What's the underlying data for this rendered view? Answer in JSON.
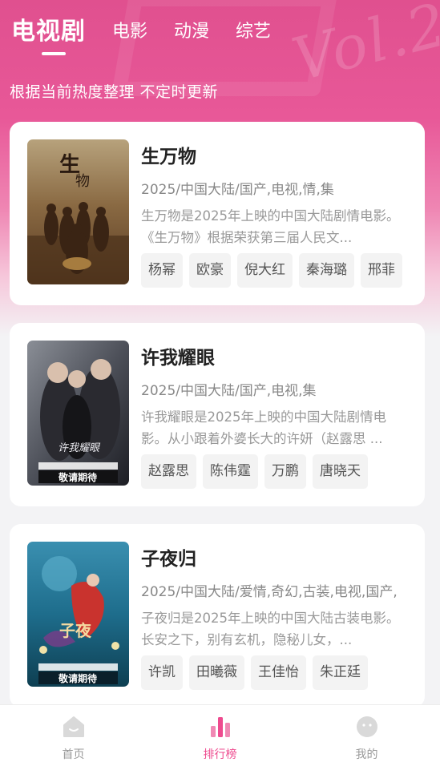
{
  "tabs": [
    {
      "label": "电视剧",
      "active": true
    },
    {
      "label": "电影",
      "active": false
    },
    {
      "label": "动漫",
      "active": false
    },
    {
      "label": "综艺",
      "active": false
    }
  ],
  "subtitle": "根据当前热度整理 不定时更新",
  "cards": [
    {
      "title": "生万物",
      "meta": "2025/中国大陆/国产,电视,情,集",
      "description": "生万物是2025年上映的中国大陆剧情电影。《生万物》根据荣获第三届人民文...",
      "actors": [
        "杨幂",
        "欧豪",
        "倪大红",
        "秦海璐",
        "邢菲"
      ]
    },
    {
      "title": "许我耀眼",
      "meta": "2025/中国大陆/国产,电视,集",
      "description": "许我耀眼是2025年上映的中国大陆剧情电影。从小跟着外婆长大的许妍（赵露思 ...",
      "actors": [
        "赵露思",
        "陈伟霆",
        "万鹏",
        "唐晓天"
      ],
      "poster_caption": "敬请期待"
    },
    {
      "title": "子夜归",
      "meta": "2025/中国大陆/爱情,奇幻,古装,电视,国产,",
      "description": "子夜归是2025年上映的中国大陆古装电影。长安之下，别有玄机，隐秘儿女，...",
      "actors": [
        "许凯",
        "田曦薇",
        "王佳怡",
        "朱正廷"
      ],
      "poster_caption": "敬请期待"
    }
  ],
  "bottom_nav": [
    {
      "label": "首页",
      "icon": "home-icon",
      "active": false
    },
    {
      "label": "排行榜",
      "icon": "ranking-icon",
      "active": true
    },
    {
      "label": "我的",
      "icon": "profile-icon",
      "active": false
    }
  ],
  "colors": {
    "accent": "#ee4b8f",
    "hero_top": "#e0508f",
    "background": "#f3f3f5"
  }
}
